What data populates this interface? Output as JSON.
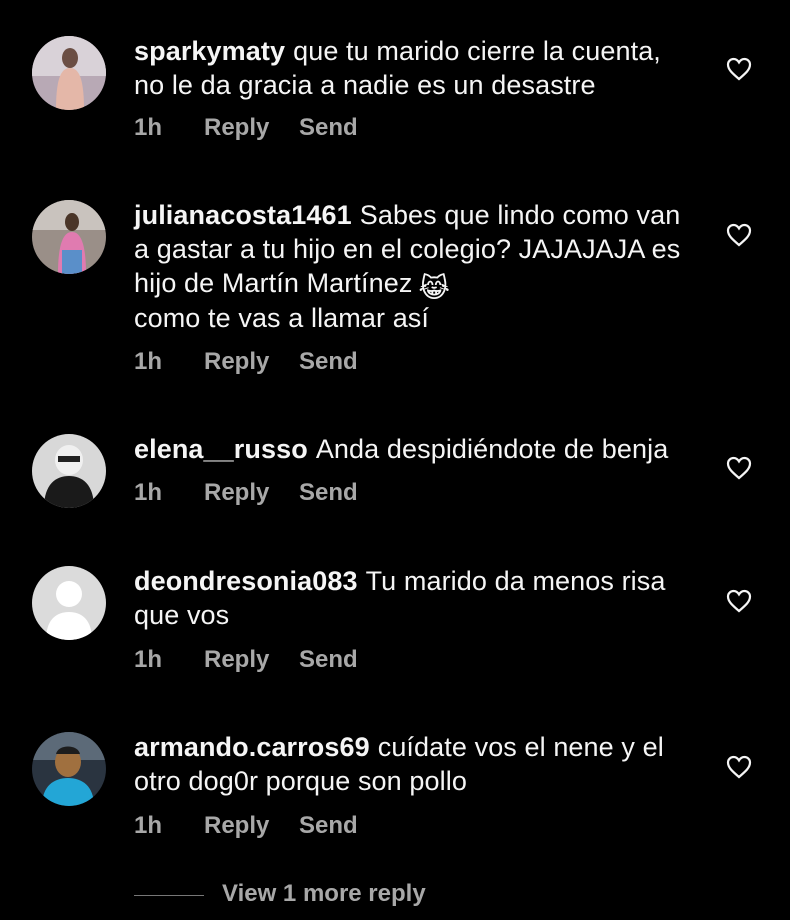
{
  "comments": [
    {
      "username": "sparkymaty",
      "text": "que tu marido cierre la cuenta, no le da gracia a nadie es un desastre",
      "time": "1h",
      "reply": "Reply",
      "send": "Send",
      "avatar_icon": "profile-photo"
    },
    {
      "username": "julianacosta1461",
      "text": "Sabes que lindo como van a gastar a tu hijo en el colegio? JAJAJAJA es hijo de Martín Martínez",
      "emoji": "😹",
      "text_after": "como te vas a llamar así",
      "time": "1h",
      "reply": "Reply",
      "send": "Send",
      "avatar_icon": "profile-photo"
    },
    {
      "username": "elena__russo",
      "text": "Anda despidiéndote de benja",
      "time": "1h",
      "reply": "Reply",
      "send": "Send",
      "avatar_icon": "profile-photo"
    },
    {
      "username": "deondresonia083",
      "text": "Tu marido da menos risa que vos",
      "time": "1h",
      "reply": "Reply",
      "send": "Send",
      "avatar_icon": "default-avatar"
    },
    {
      "username": "armando.carros69",
      "text": "cuídate vos el nene y el otro dog0r porque son pollo",
      "time": "1h",
      "reply": "Reply",
      "send": "Send",
      "avatar_icon": "profile-photo"
    }
  ],
  "view_more": "View 1 more reply",
  "colors": {
    "background": "#000000",
    "text": "#f5f5f5",
    "meta": "#a8a8a8"
  }
}
